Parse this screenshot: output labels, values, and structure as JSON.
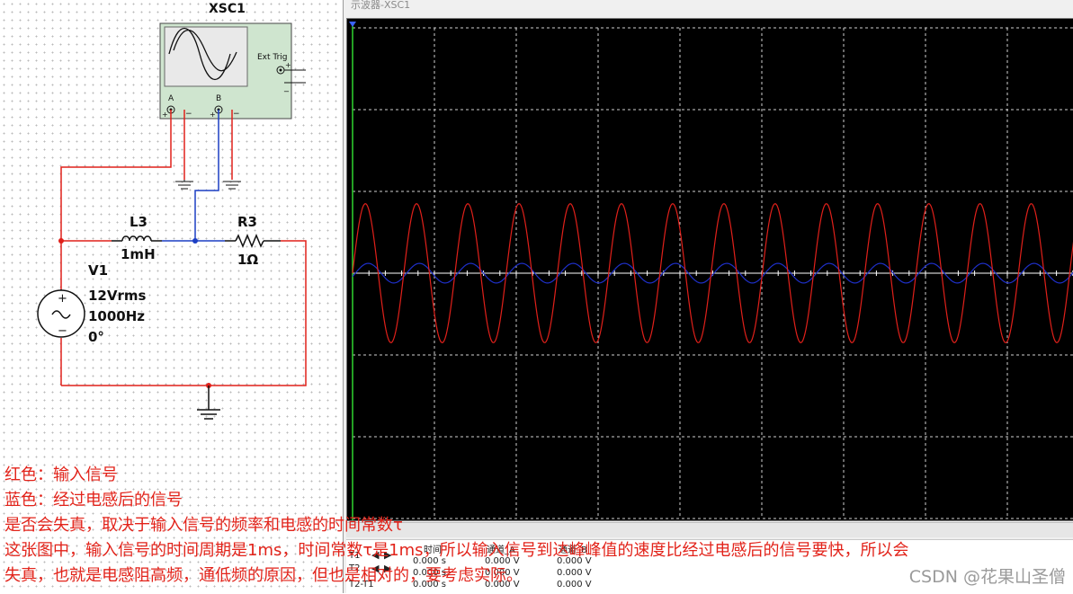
{
  "scope_window": {
    "title": "示波器-XSC1",
    "readout": {
      "col_time": "时间",
      "col_ch_a": "通道_A",
      "col_ch_b": "通道_B",
      "rows": [
        {
          "label": "T1",
          "time": "0.000 s",
          "ch_a": "0.000 V",
          "ch_b": "0.000 V"
        },
        {
          "label": "T2",
          "time": "0.000 s",
          "ch_a": "0.000 V",
          "ch_b": "0.000 V"
        },
        {
          "label": "T2-T1",
          "time": "0.000 s",
          "ch_a": "0.000 V",
          "ch_b": "0.000 V"
        }
      ]
    },
    "trace_colors": {
      "channel_a": "#e0201a",
      "channel_b": "#1e2fc8",
      "grid": "#cfcfcf",
      "background": "#000000"
    },
    "waveforms": {
      "channel_a": {
        "cycles_visible": 14.1,
        "peak_divisions": 0.85
      },
      "channel_b": {
        "cycles_visible": 14.1,
        "peak_divisions": 0.12
      }
    }
  },
  "schematic": {
    "instrument": {
      "name": "XSC1",
      "ext_trig": "Ext Trig",
      "ch_a": "A",
      "ch_b": "B"
    },
    "inductor": {
      "ref": "L3",
      "value": "1mH"
    },
    "resistor": {
      "ref": "R3",
      "value": "1Ω"
    },
    "source": {
      "ref": "V1",
      "voltage": "12Vrms",
      "frequency": "1000Hz",
      "phase": "0°"
    },
    "wire_colors": {
      "channel_a": "#e0201a",
      "channel_b": "#1c3fc4"
    }
  },
  "annotation": {
    "lines": [
      "红色：输入信号",
      "蓝色：经过电感后的信号",
      "是否会失真，取决于输入信号的频率和电感的时间常数τ",
      "这张图中，输入信号的时间周期是1ms，时间常数τ是1ms，所以输入信号到达峰峰值的速度比经过电感后的信号要快，所以会",
      "失真，也就是电感阻高频，通低频的原因，但也是相对的，要考虑实际。"
    ]
  },
  "watermark": "CSDN @花果山圣僧"
}
